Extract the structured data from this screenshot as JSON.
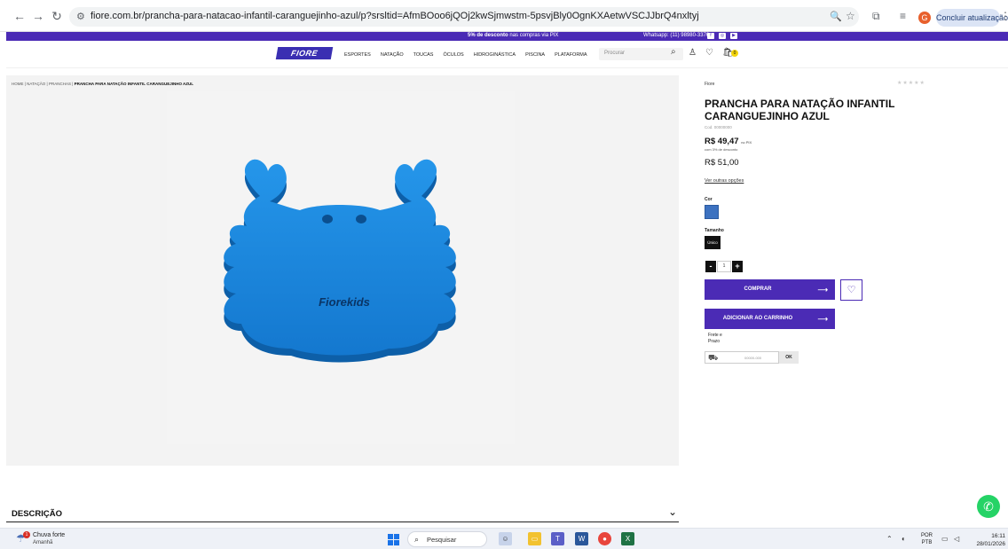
{
  "browser": {
    "url": "fiore.com.br/prancha-para-natacao-infantil-caranguejinho-azul/p?srsltid=AfmBOoo6jQOj2kwSjmwstm-5psvjBly0OgnKXAetwVSCJJbrQ4nxltyj",
    "update_button": "Concluir atualização",
    "profile_initial": "G"
  },
  "promo": {
    "text_bold": "5% de desconto",
    "text_rest": " nas compras via PIX",
    "whatsapp": "Whatsapp: (11) 98980-3376"
  },
  "header": {
    "logo": "FIORE",
    "menu": [
      "ESPORTES",
      "NATAÇÃO",
      "TOUCAS",
      "ÓCULOS",
      "HIDROGINÁSTICA",
      "PISCINA",
      "PLATAFORMA"
    ],
    "search_placeholder": "Procurar",
    "cart_count": "0"
  },
  "breadcrumb": {
    "items": [
      "HOME",
      "NATAÇÃO",
      "PRANCHAS"
    ],
    "current": "PRANCHA PARA NATAÇÃO INFANTIL CARANGUEJINHO AZUL"
  },
  "product": {
    "brand": "Fiore",
    "title": "PRANCHA PARA NATAÇÃO INFANTIL CARANGUEJINHO AZUL",
    "sku": "Cod. 00000000",
    "price_pix": "R$ 49,47",
    "price_pix_label": "no PIX",
    "price_discount_note": "com 3% de desconto",
    "price_full": "R$ 51,00",
    "other_options": "Ver outras opções",
    "color_label": "Cor",
    "color_hex": "#3d72c0",
    "size_label": "Tamanho",
    "size_value": "Único",
    "quantity": "1",
    "buy_label": "COMPRAR",
    "add_cart_label": "ADICIONAR AO CARRINHO",
    "shipping_label": "Frete e Prazo",
    "cep_placeholder": "00000-000",
    "ok_label": "OK",
    "image_brand_text": "Fiorekids"
  },
  "description": {
    "title": "DESCRIÇÃO"
  },
  "taskbar": {
    "weather_title": "Chuva forte",
    "weather_sub": "Amanhã",
    "weather_badge": "1",
    "search_label": "Pesquisar",
    "lang_1": "POR",
    "lang_2": "PTB",
    "time": "16:11",
    "date": "28/01/2026"
  },
  "colors": {
    "accent": "#4b2bb5",
    "product_blue": "#1e8ce3"
  }
}
